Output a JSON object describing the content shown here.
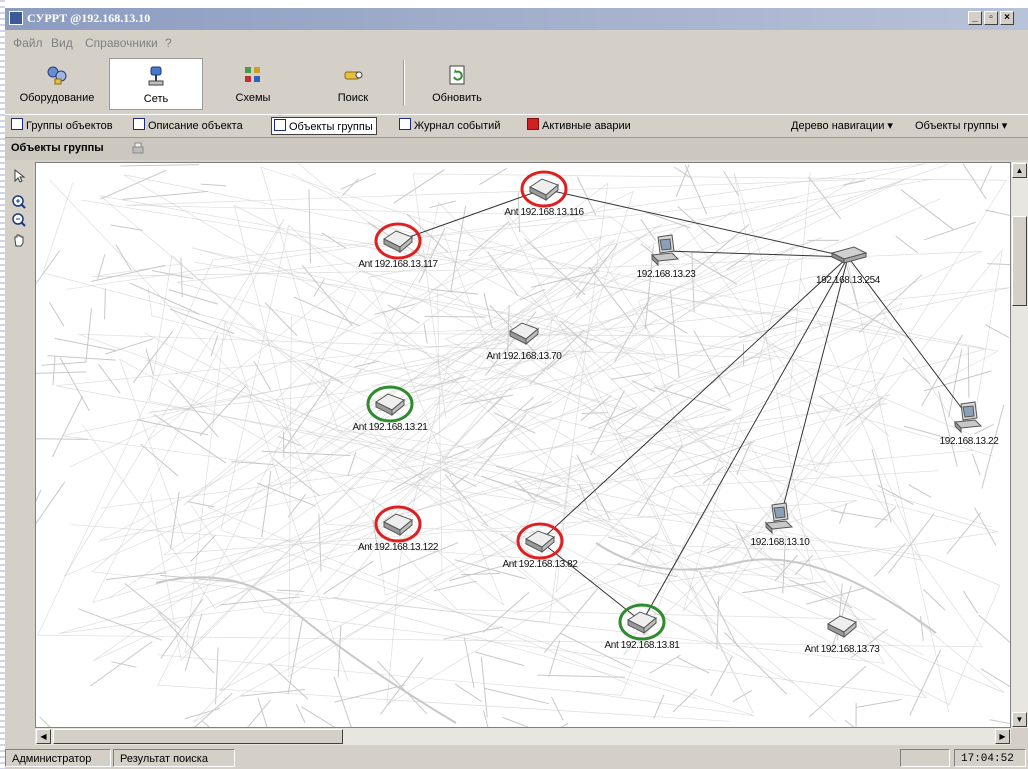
{
  "window": {
    "title": "СУРРТ @192.168.13.10",
    "buttons": [
      "_",
      "▫",
      "×"
    ]
  },
  "menu": [
    "Файл",
    "Вид",
    "Справочники",
    "?"
  ],
  "toolbar": {
    "buttons": [
      {
        "label": "Оборудование",
        "icon": "equipment-icon",
        "active": false
      },
      {
        "label": "Сеть",
        "icon": "network-icon",
        "active": true
      },
      {
        "label": "Схемы",
        "icon": "schemes-icon",
        "active": false
      },
      {
        "label": "Поиск",
        "icon": "search-icon",
        "active": false
      },
      {
        "label": "Обновить",
        "icon": "refresh-icon",
        "active": false
      }
    ]
  },
  "tabs": [
    {
      "label": "Группы объектов",
      "active": false
    },
    {
      "label": "Описание объекта",
      "active": false
    },
    {
      "label": "Объекты группы",
      "active": true
    },
    {
      "label": "Журнал событий",
      "active": false
    },
    {
      "label": "Активные аварии",
      "active": false
    }
  ],
  "right_menus": [
    "Дерево навигации ▾",
    "Объекты группы ▾"
  ],
  "panel": {
    "title": "Объекты группы"
  },
  "network": {
    "nodes": [
      {
        "id": "n116",
        "label": "Ant 192.168.13.116",
        "kind": "modem",
        "status": "red"
      },
      {
        "id": "n117",
        "label": "Ant 192.168.13.117",
        "kind": "modem",
        "status": "red"
      },
      {
        "id": "n23",
        "label": "192.168.13.23",
        "kind": "pc",
        "status": "none"
      },
      {
        "id": "n254",
        "label": "192.168.13.254",
        "kind": "switch",
        "status": "none"
      },
      {
        "id": "n70",
        "label": "Ant 192.168.13.70",
        "kind": "modem",
        "status": "none"
      },
      {
        "id": "n21",
        "label": "Ant 192.168.13.21",
        "kind": "modem",
        "status": "green"
      },
      {
        "id": "n22",
        "label": "192.168.13.22",
        "kind": "pc",
        "status": "none"
      },
      {
        "id": "n122",
        "label": "Ant 192.168.13.122",
        "kind": "modem",
        "status": "red"
      },
      {
        "id": "n82",
        "label": "Ant 192.168.13.82",
        "kind": "modem",
        "status": "red"
      },
      {
        "id": "n10",
        "label": "192.168.13.10",
        "kind": "pc",
        "status": "none"
      },
      {
        "id": "n81",
        "label": "Ant 192.168.13.81",
        "kind": "modem",
        "status": "green"
      },
      {
        "id": "n73",
        "label": "Ant 192.168.13.73",
        "kind": "modem",
        "status": "none"
      }
    ],
    "links": [
      [
        "n117",
        "n116"
      ],
      [
        "n116",
        "n254"
      ],
      [
        "n23",
        "n254"
      ],
      [
        "n254",
        "n22"
      ],
      [
        "n254",
        "n10"
      ],
      [
        "n254",
        "n82"
      ],
      [
        "n254",
        "n81"
      ],
      [
        "n82",
        "n81"
      ]
    ],
    "colors": {
      "red": "#e02020",
      "green": "#2e8b2e",
      "line": "#333333"
    }
  },
  "status": {
    "user": "Администратор",
    "search": "Результат поиска",
    "time": "17:04:52"
  }
}
